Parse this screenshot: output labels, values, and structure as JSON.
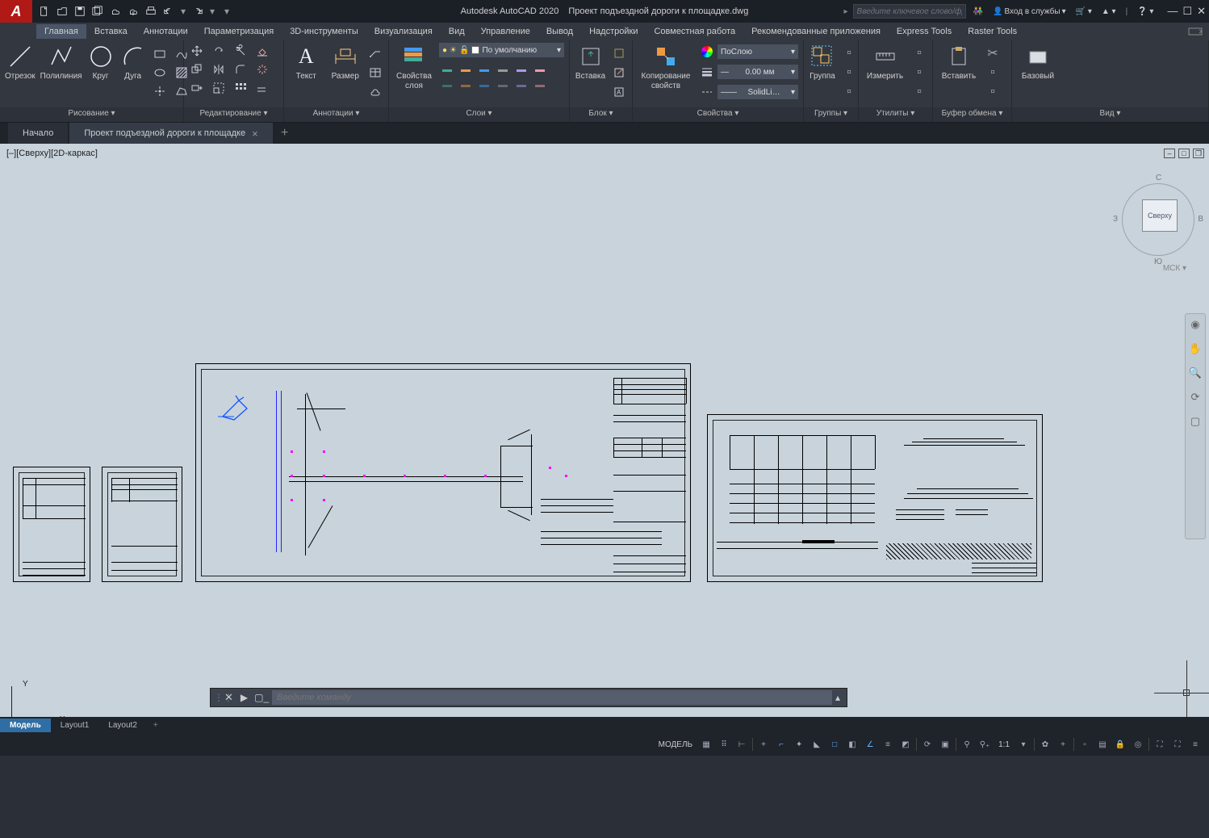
{
  "app": {
    "title": "Autodesk AutoCAD 2020",
    "file": "Проект подъездной дороги к площадке.dwg"
  },
  "search_placeholder": "Введите ключевое слово/фразу",
  "login": "Вход в службы",
  "menu": [
    "Главная",
    "Вставка",
    "Аннотации",
    "Параметризация",
    "3D-инструменты",
    "Визуализация",
    "Вид",
    "Управление",
    "Вывод",
    "Надстройки",
    "Совместная работа",
    "Рекомендованные приложения",
    "Express Tools",
    "Raster Tools"
  ],
  "tabs": {
    "start": "Начало",
    "file": "Проект подъездной дороги к площадке"
  },
  "panels": {
    "draw": {
      "title": "Рисование ▾",
      "line": "Отрезок",
      "poly": "Полилиния",
      "circle": "Круг",
      "arc": "Дуга"
    },
    "edit": {
      "title": "Редактирование ▾"
    },
    "anno": {
      "title": "Аннотации ▾",
      "text": "Текст",
      "dim": "Размер"
    },
    "layers": {
      "title": "Слои ▾",
      "props": "Свойства\nслоя",
      "current": "По умолчанию"
    },
    "block": {
      "title": "Блок ▾",
      "insert": "Вставка"
    },
    "props": {
      "title": "Свойства ▾",
      "match": "Копирование\nсвойств",
      "color": "ПоСлою",
      "lw": "0.00 мм",
      "lt": "SolidLi…"
    },
    "groups": {
      "title": "Группы ▾",
      "group": "Группа"
    },
    "util": {
      "title": "Утилиты ▾",
      "measure": "Измерить"
    },
    "clip": {
      "title": "Буфер обмена ▾",
      "paste": "Вставить"
    },
    "view": {
      "title": "Вид ▾",
      "base": "Базовый"
    }
  },
  "viewport_label": "[–][Сверху][2D-каркас]",
  "viewcube": {
    "n": "С",
    "s": "Ю",
    "e": "В",
    "w": "З",
    "top": "Сверху",
    "wcs": "МСК ▾"
  },
  "ucs": {
    "x": "X",
    "y": "Y"
  },
  "cmd": {
    "placeholder": "Введите команду"
  },
  "layouts": {
    "model": "Модель",
    "l1": "Layout1",
    "l2": "Layout2"
  },
  "status": {
    "model": "МОДЕЛЬ",
    "scale": "1:1"
  }
}
